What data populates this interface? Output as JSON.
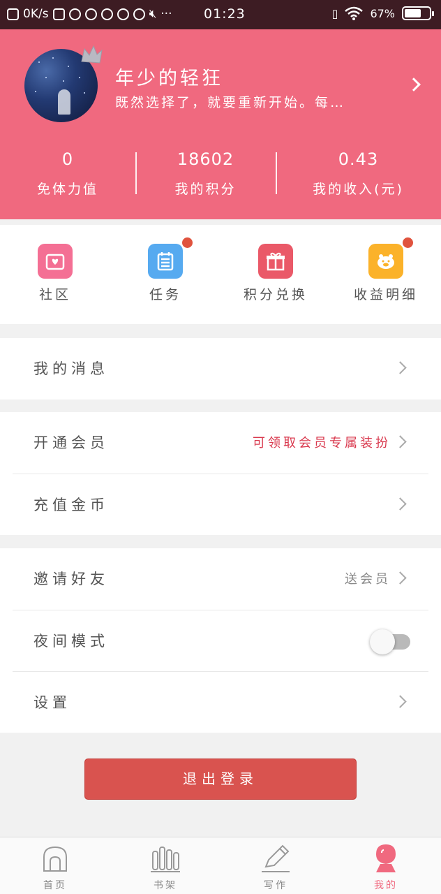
{
  "status_bar": {
    "net_speed": "0K/s",
    "time": "01:23",
    "battery": "67%",
    "battery_fraction": 0.67
  },
  "profile": {
    "username": "年少的轻狂",
    "signature": "既然选择了，就要重新开始。每…"
  },
  "stats": [
    {
      "value": "0",
      "label": "免体力值"
    },
    {
      "value": "18602",
      "label": "我的积分"
    },
    {
      "value": "0.43",
      "label": "我的收入(元)"
    }
  ],
  "quick_actions": [
    {
      "label": "社区",
      "icon": "community-icon",
      "color": "#f46f94",
      "dot": false
    },
    {
      "label": "任务",
      "icon": "task-icon",
      "color": "#56aaf0",
      "dot": true
    },
    {
      "label": "积分兑换",
      "icon": "gift-icon",
      "color": "#ea5968",
      "dot": false
    },
    {
      "label": "收益明细",
      "icon": "piggy-bank-icon",
      "color": "#fbb22a",
      "dot": true
    }
  ],
  "menu": {
    "messages": {
      "label": "我的消息"
    },
    "vip": {
      "label": "开通会员",
      "extra": "可领取会员专属装扮"
    },
    "recharge": {
      "label": "充值金币"
    },
    "invite": {
      "label": "邀请好友",
      "extra": "送会员"
    },
    "night_mode": {
      "label": "夜间模式",
      "enabled": false
    },
    "settings": {
      "label": "设置"
    }
  },
  "logout_label": "退出登录",
  "tabs": [
    {
      "label": "首页",
      "icon": "home-icon",
      "active": false
    },
    {
      "label": "书架",
      "icon": "bookshelf-icon",
      "active": false
    },
    {
      "label": "写作",
      "icon": "pen-icon",
      "active": false
    },
    {
      "label": "我的",
      "icon": "profile-icon",
      "active": true
    }
  ],
  "colors": {
    "brand": "#f0697f",
    "status_bar": "#3d1c23",
    "logout": "#d9534f",
    "badge_dot": "#e0533e",
    "vip_highlight": "#d9394e"
  }
}
